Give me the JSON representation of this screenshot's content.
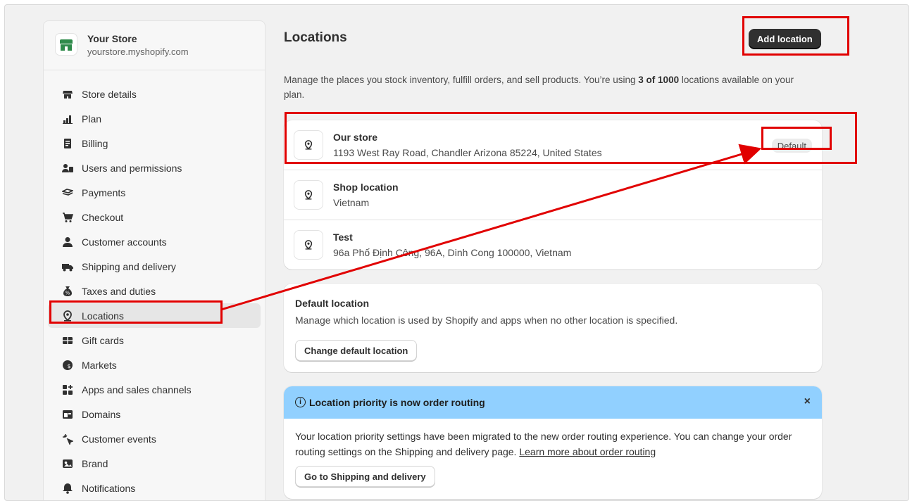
{
  "store": {
    "name": "Your Store",
    "url": "yourstore.myshopify.com"
  },
  "sidebar": {
    "items": [
      {
        "label": "Store details",
        "icon": "store-icon"
      },
      {
        "label": "Plan",
        "icon": "plan-icon"
      },
      {
        "label": "Billing",
        "icon": "billing-icon"
      },
      {
        "label": "Users and permissions",
        "icon": "users-icon"
      },
      {
        "label": "Payments",
        "icon": "payments-icon"
      },
      {
        "label": "Checkout",
        "icon": "cart-icon"
      },
      {
        "label": "Customer accounts",
        "icon": "person-icon"
      },
      {
        "label": "Shipping and delivery",
        "icon": "truck-icon"
      },
      {
        "label": "Taxes and duties",
        "icon": "tax-icon"
      },
      {
        "label": "Locations",
        "icon": "location-icon",
        "active": true
      },
      {
        "label": "Gift cards",
        "icon": "gift-card-icon"
      },
      {
        "label": "Markets",
        "icon": "globe-icon"
      },
      {
        "label": "Apps and sales channels",
        "icon": "apps-icon"
      },
      {
        "label": "Domains",
        "icon": "domains-icon"
      },
      {
        "label": "Customer events",
        "icon": "sparkle-icon"
      },
      {
        "label": "Brand",
        "icon": "brand-icon"
      },
      {
        "label": "Notifications",
        "icon": "bell-icon"
      }
    ]
  },
  "page": {
    "title": "Locations",
    "add_button": "Add location",
    "desc_prefix": "Manage the places you stock inventory, fulfill orders, and sell products. You’re using ",
    "desc_bold": "3 of 1000",
    "desc_suffix": " locations available on your plan."
  },
  "locations": [
    {
      "name": "Our store",
      "address": "1193 West Ray Road, Chandler Arizona 85224, United States",
      "badge": "Default"
    },
    {
      "name": "Shop location",
      "address": "Vietnam"
    },
    {
      "name": "Test",
      "address": "96a Phố Định Công, 96A, Dinh Cong 100000, Vietnam"
    }
  ],
  "default_location": {
    "title": "Default location",
    "text": "Manage which location is used by Shopify and apps when no other location is specified.",
    "button": "Change default location"
  },
  "banner": {
    "title": "Location priority is now order routing",
    "text": "Your location priority settings have been migrated to the new order routing experience. You can change your order routing settings on the Shipping and delivery page. ",
    "link": "Learn more about order routing",
    "button": "Go to Shipping and delivery",
    "close": "×",
    "color": "#91d0ff"
  },
  "annotations": {
    "color": "#e10000"
  }
}
